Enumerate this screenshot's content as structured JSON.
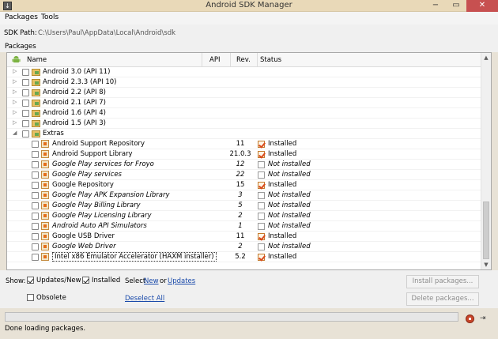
{
  "window": {
    "title": "Android SDK Manager",
    "app_icon": "download-arrow-icon"
  },
  "menu": {
    "items": [
      "Packages",
      "Tools"
    ]
  },
  "sdk_path": {
    "label": "SDK Path:",
    "value": "C:\\Users\\Paul\\AppData\\Local\\Android\\sdk"
  },
  "packages_label": "Packages",
  "table": {
    "columns": {
      "name": "Name",
      "api": "API",
      "rev": "Rev.",
      "status": "Status"
    },
    "rows": [
      {
        "name": "Android 3.0 (API 11)",
        "level": 0,
        "type": "folder",
        "expander": "▷"
      },
      {
        "name": "Android 2.3.3 (API 10)",
        "level": 0,
        "type": "folder",
        "expander": "▷"
      },
      {
        "name": "Android 2.2 (API 8)",
        "level": 0,
        "type": "folder",
        "expander": "▷"
      },
      {
        "name": "Android 2.1 (API 7)",
        "level": 0,
        "type": "folder",
        "expander": "▷"
      },
      {
        "name": "Android 1.6 (API 4)",
        "level": 0,
        "type": "folder",
        "expander": "▷"
      },
      {
        "name": "Android 1.5 (API 3)",
        "level": 0,
        "type": "folder",
        "expander": "▷"
      },
      {
        "name": "Extras",
        "level": 0,
        "type": "folder",
        "expander": "◢"
      },
      {
        "name": "Android Support Repository",
        "level": 1,
        "type": "pkg",
        "rev": "11",
        "status": "Installed",
        "installed": true
      },
      {
        "name": "Android Support Library",
        "level": 1,
        "type": "pkg",
        "rev": "21.0.3",
        "status": "Installed",
        "installed": true
      },
      {
        "name": "Google Play services for Froyo",
        "level": 1,
        "type": "pkg",
        "rev": "12",
        "status": "Not installed",
        "installed": false
      },
      {
        "name": "Google Play services",
        "level": 1,
        "type": "pkg",
        "rev": "22",
        "status": "Not installed",
        "installed": false
      },
      {
        "name": "Google Repository",
        "level": 1,
        "type": "pkg",
        "rev": "15",
        "status": "Installed",
        "installed": true
      },
      {
        "name": "Google Play APK Expansion Library",
        "level": 1,
        "type": "pkg",
        "rev": "3",
        "status": "Not installed",
        "installed": false
      },
      {
        "name": "Google Play Billing Library",
        "level": 1,
        "type": "pkg",
        "rev": "5",
        "status": "Not installed",
        "installed": false
      },
      {
        "name": "Google Play Licensing Library",
        "level": 1,
        "type": "pkg",
        "rev": "2",
        "status": "Not installed",
        "installed": false
      },
      {
        "name": "Android Auto API Simulators",
        "level": 1,
        "type": "pkg",
        "rev": "1",
        "status": "Not installed",
        "installed": false
      },
      {
        "name": "Google USB Driver",
        "level": 1,
        "type": "pkg",
        "rev": "11",
        "status": "Installed",
        "installed": true
      },
      {
        "name": "Google Web Driver",
        "level": 1,
        "type": "pkg",
        "rev": "2",
        "status": "Not installed",
        "installed": false
      },
      {
        "name": "Intel x86 Emulator Accelerator (HAXM installer)",
        "level": 1,
        "type": "pkg",
        "rev": "5.2",
        "status": "Installed",
        "installed": true,
        "selected": true
      }
    ]
  },
  "show": {
    "label": "Show:",
    "updates_new": {
      "label": "Updates/New",
      "checked": true
    },
    "installed": {
      "label": "Installed",
      "checked": true
    },
    "select_prefix": "Select",
    "select_new": "New",
    "select_or": "or",
    "select_updates": "Updates",
    "obsolete": {
      "label": "Obsolete",
      "checked": false
    },
    "deselect_all": "Deselect All",
    "install_button": "Install packages...",
    "delete_button": "Delete packages..."
  },
  "status_text": "Done loading packages."
}
